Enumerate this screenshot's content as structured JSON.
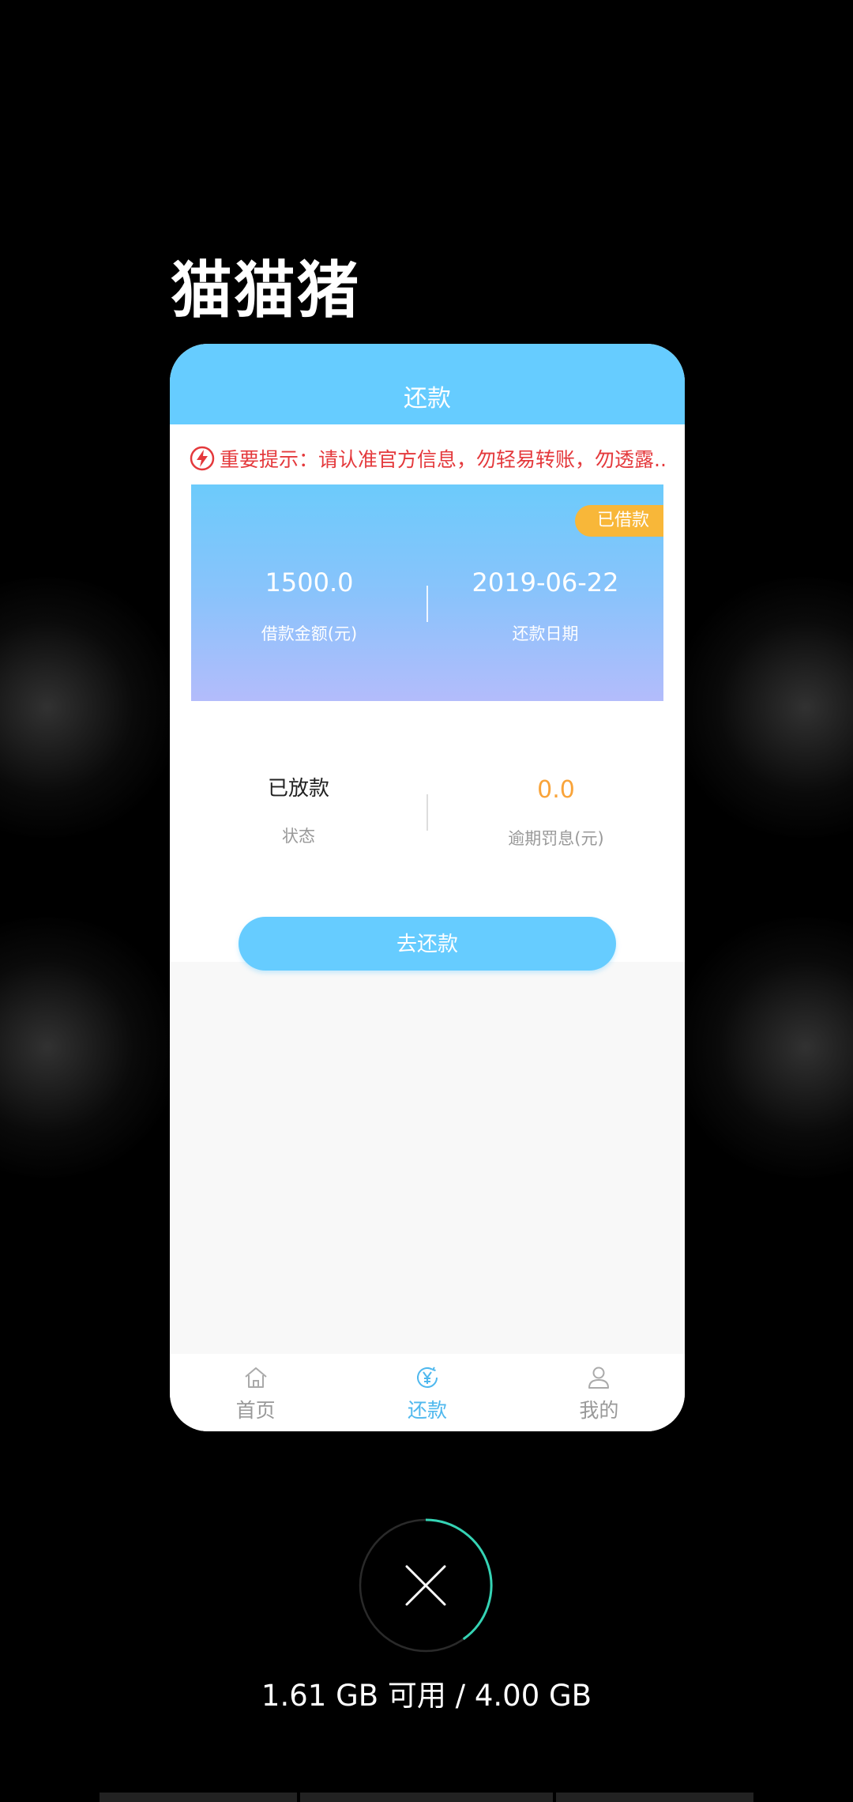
{
  "app": {
    "title": "猫猫猪"
  },
  "screen": {
    "header_title": "还款",
    "notice": "重要提示：请认准官方信息，勿轻易转账，勿透露..",
    "loan": {
      "badge": "已借款",
      "amount": "1500.0",
      "amount_label": "借款金额(元)",
      "date": "2019-06-22",
      "date_label": "还款日期"
    },
    "status": {
      "value": "已放款",
      "label": "状态",
      "penalty": "0.0",
      "penalty_label": "逾期罚息(元)"
    },
    "repay_button": "去还款",
    "tabs": [
      {
        "label": "首页",
        "icon": "home-icon"
      },
      {
        "label": "还款",
        "icon": "yen-icon"
      },
      {
        "label": "我的",
        "icon": "user-icon"
      }
    ]
  },
  "system": {
    "memory_text": "1.61 GB 可用 / 4.00 GB",
    "memory_available_fraction": 0.4025
  },
  "colors": {
    "accent": "#66ccff",
    "badge": "#f8b739",
    "notice": "#e4393c",
    "penalty": "#f9a43a",
    "ring": "#35d3b4"
  }
}
